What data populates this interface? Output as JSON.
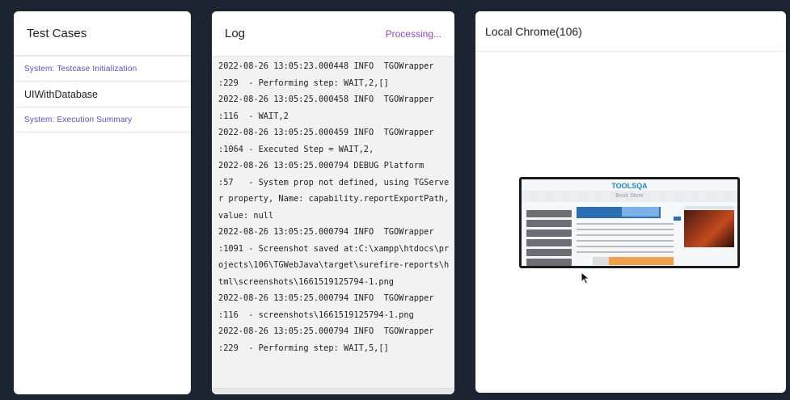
{
  "test_cases": {
    "title": "Test Cases",
    "items": [
      {
        "label": "System: Testcase Initialization",
        "kind": "system"
      },
      {
        "label": "UIWithDatabase",
        "kind": "main"
      },
      {
        "label": "System: Execution Summary",
        "kind": "system"
      }
    ]
  },
  "log": {
    "title": "Log",
    "status": "Processing...",
    "lines": [
      "2022-08-26 13:05:23.000448 INFO  TGOWrapper",
      ":229  - Performing step: WAIT,2,[]",
      "2022-08-26 13:05:25.000458 INFO  TGOWrapper",
      ":116  - WAIT,2",
      "2022-08-26 13:05:25.000459 INFO  TGOWrapper",
      ":1064 - Executed Step = WAIT,2,",
      "2022-08-26 13:05:25.000794 DEBUG Platform",
      ":57   - System prop not defined, using TGServe",
      "r property, Name: capability.reportExportPath,",
      "value: null",
      "2022-08-26 13:05:25.000794 INFO  TGOWrapper",
      ":1091 - Screenshot saved at:C:\\xampp\\htdocs\\pr",
      "ojects\\106\\TGWebJava\\target\\surefire-reports\\h",
      "tml\\screenshots\\1661519125794-1.png",
      "2022-08-26 13:05:25.000794 INFO  TGOWrapper",
      ":116  - screenshots\\1661519125794-1.png",
      "2022-08-26 13:05:25.000794 INFO  TGOWrapper",
      ":229  - Performing step: WAIT,5,[]"
    ]
  },
  "browser": {
    "title": "Local Chrome(106)",
    "screenshot": {
      "logo": "TOOLSQA",
      "page_title": "Book Store"
    }
  },
  "colors": {
    "background": "#1b2430",
    "system_item": "#5b4bd8",
    "processing": "#9b3fc9"
  }
}
